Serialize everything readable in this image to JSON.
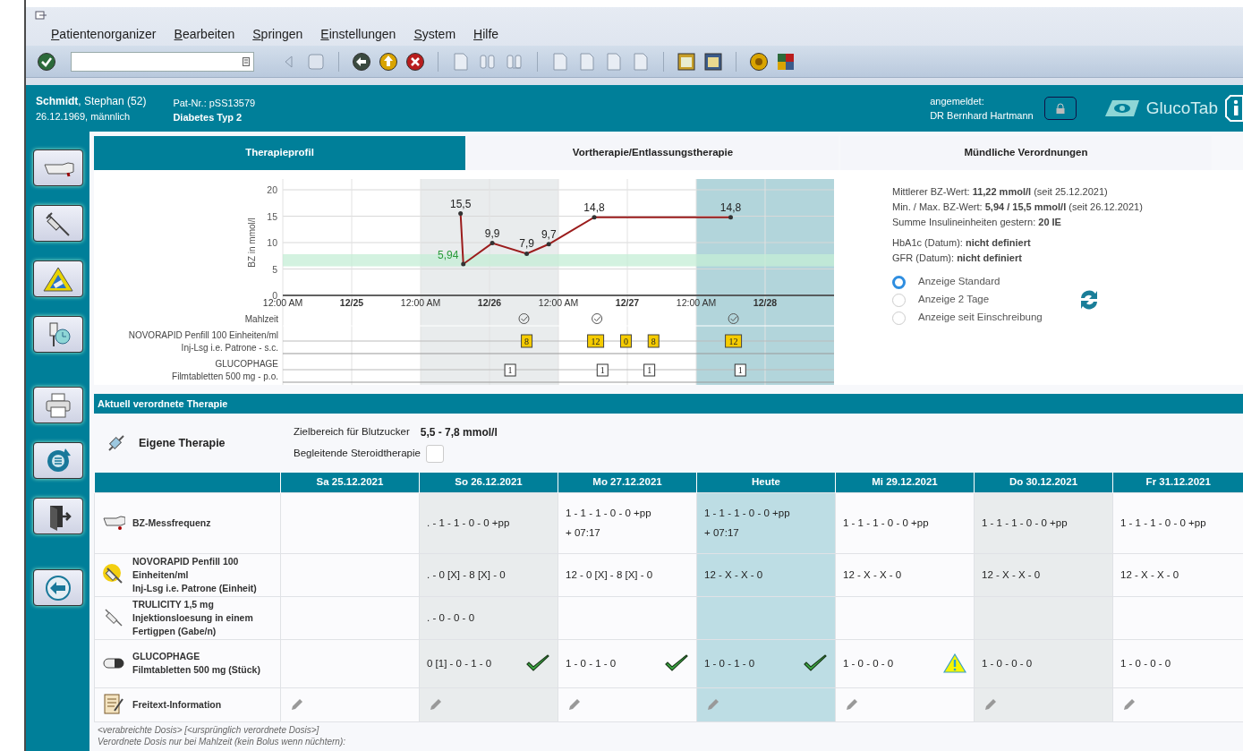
{
  "menu": [
    "Patientenorganizer",
    "Bearbeiten",
    "Springen",
    "Einstellungen",
    "System",
    "Hilfe"
  ],
  "header": {
    "patient": "**Schmidt**, Stephan (52)",
    "birth": "26.12.1969, männlich",
    "pat_nr": "Pat-Nr.: pSS13579",
    "diagnosis": "Diabetes Typ 2",
    "login_label": "angemeldet:",
    "user": "DR Bernhard Hartmann",
    "logo": "GlucoTab"
  },
  "tabs": [
    {
      "label": "Therapieprofil",
      "selected": true
    },
    {
      "label": "Vortherapie/Entlassungstherapie",
      "selected": false
    },
    {
      "label": "Mündliche Verordnungen",
      "selected": false
    }
  ],
  "chart": {
    "chart_data": {
      "type": "line",
      "ylabel": "BZ in mmol/l",
      "x": [
        25.79,
        25.81,
        26.02,
        26.27,
        26.43,
        26.76,
        27.75
      ],
      "series": [
        {
          "color": "#9b1c1c",
          "values": [
            15.5,
            5.94,
            9.9,
            7.9,
            9.7,
            14.8,
            14.8
          ]
        }
      ],
      "value_labels": [
        "15,5",
        "5,94",
        "9,9",
        "7,9",
        "9,7",
        "14,8",
        "14,8"
      ],
      "xlim": [
        24.5,
        28.5
      ],
      "ylim": [
        0,
        20
      ],
      "grid": true,
      "xticks": [
        {
          "value": 24.5,
          "label": "12:00 AM"
        },
        {
          "value": 25,
          "label": "12/25"
        },
        {
          "value": 25.5,
          "label": "12:00 AM"
        },
        {
          "value": 26,
          "label": "12/26"
        },
        {
          "value": 26.5,
          "label": "12:00 AM"
        },
        {
          "value": 27,
          "label": "12/27"
        },
        {
          "value": 27.5,
          "label": "12:00 AM"
        },
        {
          "value": 28,
          "label": "12/28"
        }
      ],
      "yticks": [
        0,
        5,
        10,
        15,
        20
      ],
      "bands": [
        {
          "axis": "x",
          "from": 25.5,
          "to": 26.5,
          "color": "#e9eced"
        },
        {
          "axis": "x",
          "from": 27.5,
          "to": 28.5,
          "color": "#b2d5db"
        },
        {
          "axis": "y",
          "from": 5.5,
          "to": 7.8,
          "color": "#c4edd5"
        }
      ]
    },
    "tracks": [
      {
        "kind": "meal",
        "lines": [
          "Mahlzeit"
        ],
        "events": [
          {
            "checked": true
          },
          {
            "checked": true
          },
          {
            "checked": true
          }
        ]
      },
      {
        "kind": "insulin",
        "lines": [
          "NOVORAPID Penfill 100 Einheiten/ml",
          "Inj-Lsg i.e. Patrone - s.c."
        ],
        "events": [
          {
            "label": "8"
          },
          {
            "label": "12"
          },
          {
            "label": "0"
          },
          {
            "label": "8"
          },
          {
            "label": "12"
          }
        ]
      },
      {
        "kind": "tablet",
        "lines": [
          "GLUCOPHAGE",
          "Filmtabletten  500 mg - p.o."
        ],
        "events": [
          {
            "label": "1"
          },
          {
            "label": "1"
          },
          {
            "label": "1"
          },
          {
            "label": "1"
          }
        ]
      }
    ]
  },
  "stat_groups": [
    {
      "lines": [
        "Mittlerer BZ-Wert: **11,22 mmol/l** (seit 25.12.2021)",
        "Min. / Max. BZ-Wert: **5,94 / 15,5 mmol/l** (seit 26.12.2021)",
        "Summe Insulineinheiten gestern: **20 IE**"
      ]
    },
    {
      "lines": [
        "HbA1c (Datum): **nicht definiert**",
        "GFR (Datum): **nicht definiert**"
      ]
    }
  ],
  "view_options": [
    {
      "label": "Anzeige Standard",
      "selected": true
    },
    {
      "label": "Anzeige 2 Tage",
      "selected": false
    },
    {
      "label": "Anzeige seit Einschreibung",
      "selected": false
    }
  ],
  "section_title": "Aktuell verordnete Therapie",
  "therapy": {
    "title": "Eigene Therapie",
    "target_label": "Zielbereich für Blutzucker",
    "target_value": "5,5 - 7,8 mmol/l",
    "steroid_label": "Begleitende Steroidtherapie",
    "steroid_checked": false
  },
  "table": {
    "columns": [
      {
        "label": "Sa 25.12.2021",
        "kind": "plain"
      },
      {
        "label": "So 26.12.2021",
        "kind": "shaded"
      },
      {
        "label": "Mo 27.12.2021",
        "kind": "plain"
      },
      {
        "label": "Heute",
        "kind": "today"
      },
      {
        "label": "Mi 29.12.2021",
        "kind": "plain"
      },
      {
        "label": "Do 30.12.2021",
        "kind": "shaded"
      },
      {
        "label": "Fr 31.12.2021",
        "kind": "plain"
      }
    ],
    "rows": [
      {
        "kind": "glucose",
        "title": [
          "BZ-Messfrequenz"
        ],
        "cells": [
          {},
          {
            "lines": [
              ". - 1 - 1 - 0 - 0 +pp"
            ]
          },
          {
            "lines": [
              "1 - 1 - 1 - 0 - 0 +pp",
              "+ 07:17"
            ]
          },
          {
            "lines": [
              "1 - 1 - 1 - 0 - 0 +pp",
              "+ 07:17"
            ]
          },
          {
            "lines": [
              "1 - 1 - 1 - 0 - 0 +pp"
            ]
          },
          {
            "lines": [
              "1 - 1 - 1 - 0 - 0 +pp"
            ]
          },
          {
            "lines": [
              "1 - 1 - 1 - 0 - 0 +pp"
            ]
          }
        ]
      },
      {
        "kind": "insulin",
        "title": [
          "NOVORAPID Penfill 100",
          "Einheiten/ml",
          "Inj-Lsg i.e. Patrone (Einheit)"
        ],
        "cells": [
          {},
          {
            "lines": [
              ". - 0 [X] - 8 [X] - 0"
            ]
          },
          {
            "lines": [
              "12 - 0 [X] - 8 [X] - 0"
            ]
          },
          {
            "lines": [
              "12 - X - X - 0"
            ]
          },
          {
            "lines": [
              "12 - X - X - 0"
            ]
          },
          {
            "lines": [
              "12 - X - X - 0"
            ]
          },
          {
            "lines": [
              "12 - X - X - 0"
            ]
          }
        ]
      },
      {
        "kind": "injection",
        "title": [
          "TRULICITY 1,5 mg",
          "Injektionsloesung in einem",
          "Fertigpen (Gabe/n)"
        ],
        "cells": [
          {},
          {
            "lines": [
              ". - 0 - 0 - 0"
            ]
          },
          {},
          {},
          {},
          {},
          {}
        ]
      },
      {
        "kind": "tablet",
        "title": [
          "GLUCOPHAGE",
          "Filmtabletten 500 mg (Stück)"
        ],
        "cells": [
          {
            "confirmed": false,
            "warning": false
          },
          {
            "lines": [
              "0 [1] - 0 - 1 - 0"
            ],
            "confirmed": true,
            "warning": false
          },
          {
            "lines": [
              "1 - 0 - 1 - 0"
            ],
            "confirmed": true,
            "warning": false
          },
          {
            "lines": [
              "1 - 0 - 1 - 0"
            ],
            "confirmed": true,
            "warning": false
          },
          {
            "lines": [
              "1 - 0 - 0 - 0"
            ],
            "confirmed": false,
            "warning": true
          },
          {
            "lines": [
              "1 - 0 - 0 - 0"
            ],
            "confirmed": false,
            "warning": false
          },
          {
            "lines": [
              "1 - 0 - 0 - 0"
            ],
            "confirmed": false,
            "warning": false
          }
        ]
      },
      {
        "kind": "note",
        "title": [
          "Freitext-Information"
        ],
        "cells": [
          {
            "editable": true
          },
          {
            "editable": true
          },
          {
            "editable": true
          },
          {
            "editable": true
          },
          {
            "editable": true
          },
          {
            "editable": true
          },
          {
            "editable": true
          }
        ]
      }
    ]
  },
  "notes": [
    "<verabreichte Dosis> [<ursprünglich verordnete Dosis>]",
    "Verordnete Dosis nur bei Mahlzeit (kein Bolus wenn nüchtern):"
  ]
}
